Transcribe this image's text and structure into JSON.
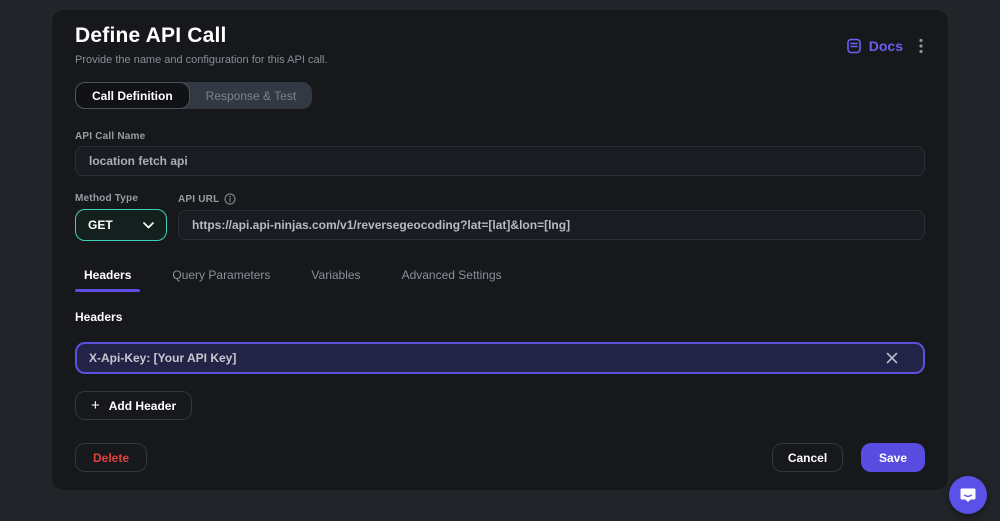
{
  "header": {
    "title": "Define API Call",
    "subtitle": "Provide the name and configuration for this API call.",
    "docs_label": "Docs"
  },
  "top_tabs": [
    {
      "label": "Call Definition",
      "active": true
    },
    {
      "label": "Response & Test",
      "active": false
    }
  ],
  "fields": {
    "api_call_name": {
      "label": "API Call Name",
      "value": "location fetch api"
    },
    "method_type": {
      "label": "Method Type",
      "value": "GET"
    },
    "api_url": {
      "label": "API URL",
      "value": "https://api.api-ninjas.com/v1/reversegeocoding?lat=[lat]&lon=[lng]"
    }
  },
  "section_tabs": [
    {
      "label": "Headers",
      "active": true
    },
    {
      "label": "Query Parameters",
      "active": false
    },
    {
      "label": "Variables",
      "active": false
    },
    {
      "label": "Advanced Settings",
      "active": false
    }
  ],
  "headers_section": {
    "label": "Headers",
    "entries": [
      {
        "value": "X-Api-Key: [Your API Key]"
      }
    ],
    "add_button_label": "Add Header"
  },
  "footer": {
    "delete_label": "Delete",
    "cancel_label": "Cancel",
    "save_label": "Save"
  },
  "icons": {
    "docs": "docs-icon",
    "kebab": "kebab-menu-icon",
    "info": "info-icon",
    "chevron": "chevron-down-icon",
    "plus": "plus-icon",
    "close": "close-icon",
    "chat": "chat-bubble-icon"
  },
  "colors": {
    "page_bg": "#212429",
    "card_bg": "#16181c",
    "accent_purple": "#5b4fe0",
    "method_teal": "#3fd0b5",
    "delete_red": "#de4340",
    "save_bg": "#584de0"
  }
}
